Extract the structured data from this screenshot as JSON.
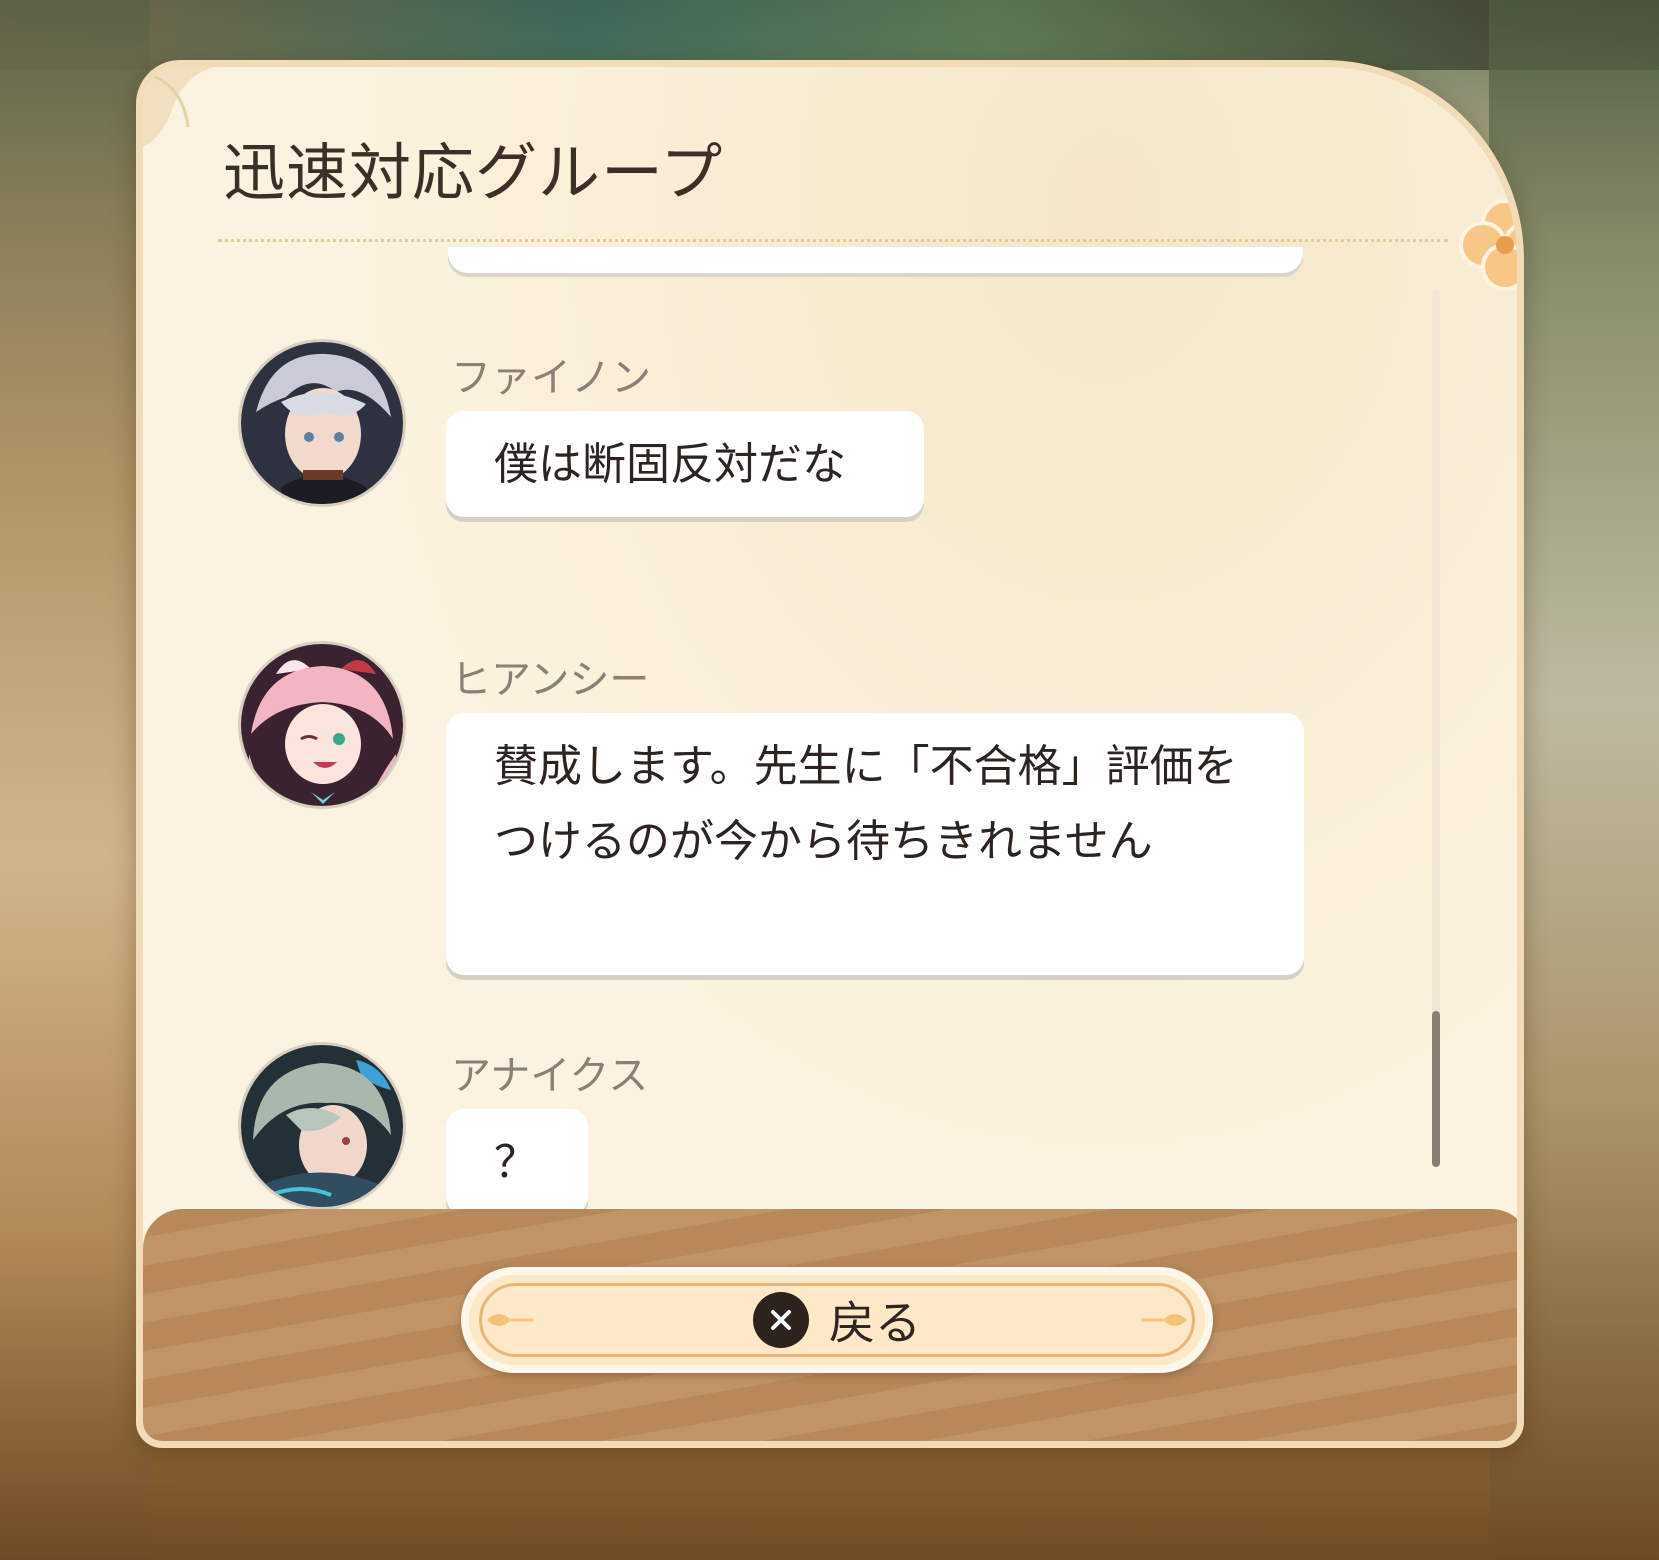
{
  "header": {
    "title": "迅速対応グループ"
  },
  "messages": [
    {
      "sender": "ファイノン",
      "text": "僕は断固反対だな",
      "avatar": "silver-haired-character-avatar"
    },
    {
      "sender": "ヒアンシー",
      "text": "賛成します。先生に「不合格」評価をつけるのが今から待ちきれません",
      "avatar": "pink-haired-character-avatar"
    },
    {
      "sender": "アナイクス",
      "text": "？",
      "avatar": "green-haired-character-avatar"
    }
  ],
  "footer": {
    "back_label": "戻る",
    "back_icon": "close-x-icon"
  },
  "colors": {
    "panel": "#fbf3df",
    "footer": "#b8885a",
    "button": "#fde8c8",
    "accent": "#f5c27a"
  }
}
